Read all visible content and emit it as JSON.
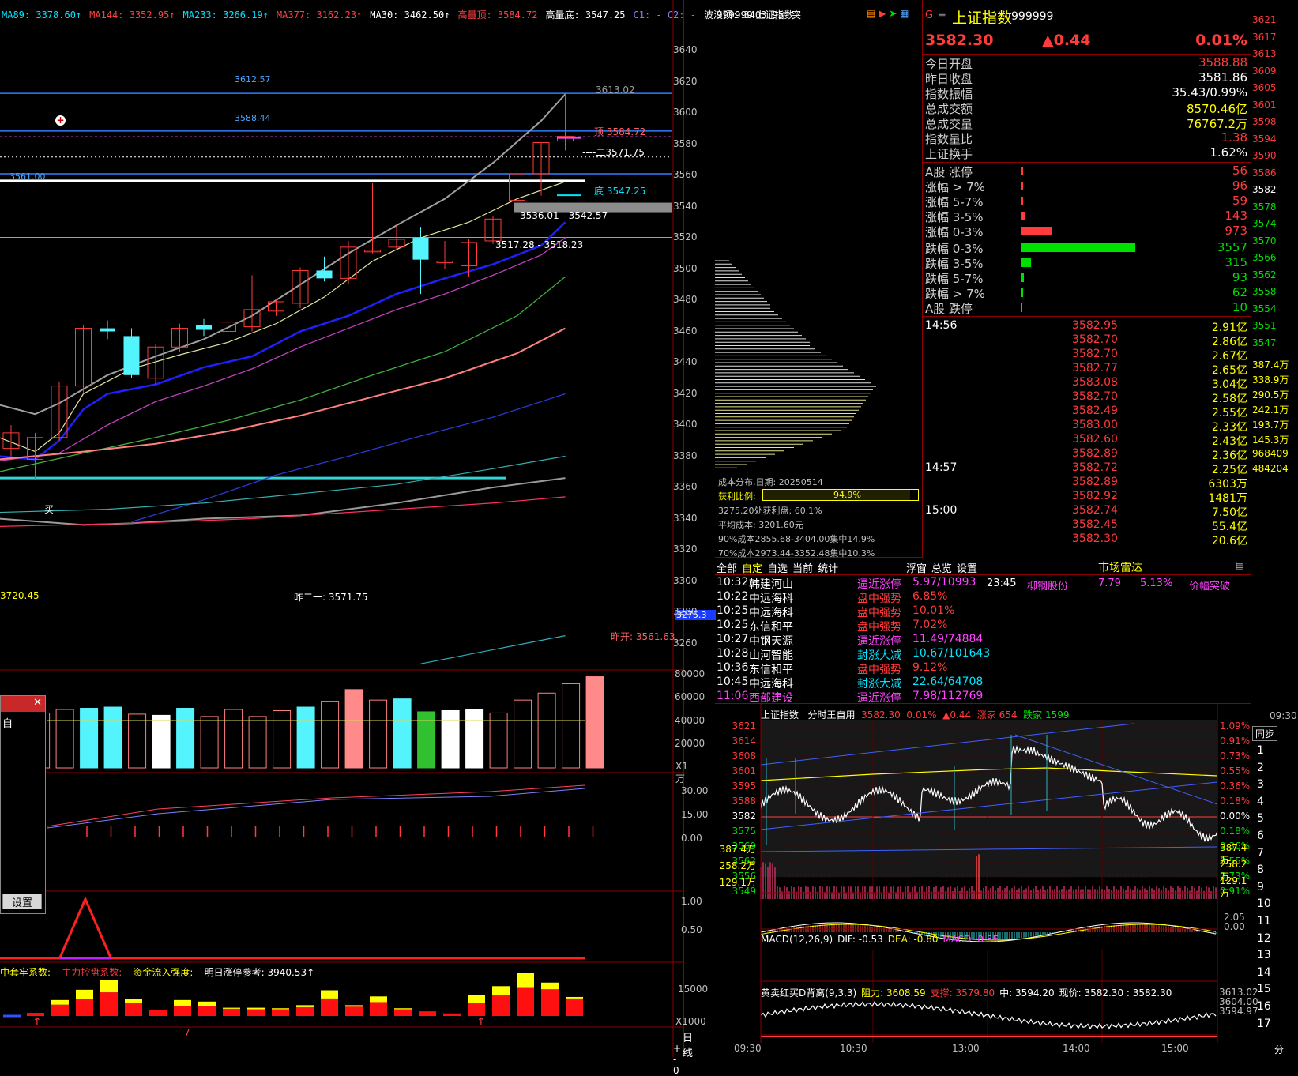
{
  "main_chart": {
    "ma_legend": [
      {
        "text": "MA89: 3378.60↑",
        "color": "#00e5ff"
      },
      {
        "text": "MA144: 3352.95↑",
        "color": "#ff4040"
      },
      {
        "text": "MA233: 3266.19↑",
        "color": "#00e5ff"
      },
      {
        "text": "MA377: 3162.23↑",
        "color": "#ff4040"
      },
      {
        "text": "MA30: 3462.50↑",
        "color": "#ffffff"
      },
      {
        "text": "高量顶: 3584.72",
        "color": "#ff4040"
      },
      {
        "text": "高量底: 3547.25",
        "color": "#ffffff"
      },
      {
        "text": "C1: - C2: -",
        "color": "#8080ff"
      },
      {
        "text": "波浪顶: 3403.95",
        "color": "#ffffff"
      },
      {
        "text": "突",
        "color": "#ffffff"
      }
    ],
    "y_ticks": [
      "3640",
      "3620",
      "3600",
      "3580",
      "3560",
      "3540",
      "3520",
      "3500",
      "3480",
      "3460",
      "3440",
      "3420",
      "3400",
      "3380",
      "3360",
      "3340",
      "3320",
      "3300",
      "3280",
      "3260"
    ],
    "annotations": {
      "line_3612": "3612.57",
      "line_3588": "3588.44",
      "line_3561": "3561.00",
      "high": "3613.02",
      "top": "顶  3584.72",
      "second": "----二3571.75",
      "bottom": "底  3547.25",
      "range1": "3536.01 - 3542.57",
      "range2": "3517.28 - 3518.23",
      "left_value": "3720.45",
      "yest_second": "昨二一:  3571.75",
      "yest_open": "昨开:  3561.63",
      "current_tag": "3275.3",
      "buy_label": "买"
    },
    "candles": [
      {
        "o": 3395,
        "c": 3385,
        "h": 3400,
        "l": 3380,
        "color": "red"
      },
      {
        "o": 3378,
        "c": 3392,
        "h": 3395,
        "l": 3365,
        "color": "red"
      },
      {
        "o": 3392,
        "c": 3425,
        "h": 3428,
        "l": 3390,
        "color": "red"
      },
      {
        "o": 3425,
        "c": 3462,
        "h": 3464,
        "l": 3420,
        "color": "red"
      },
      {
        "o": 3460,
        "c": 3462,
        "h": 3467,
        "l": 3455,
        "color": "cyan"
      },
      {
        "o": 3457,
        "c": 3432,
        "h": 3462,
        "l": 3430,
        "color": "cyan"
      },
      {
        "o": 3430,
        "c": 3450,
        "h": 3452,
        "l": 3426,
        "color": "red"
      },
      {
        "o": 3450,
        "c": 3462,
        "h": 3465,
        "l": 3447,
        "color": "red"
      },
      {
        "o": 3461,
        "c": 3464,
        "h": 3468,
        "l": 3457,
        "color": "cyan"
      },
      {
        "o": 3460,
        "c": 3466,
        "h": 3470,
        "l": 3456,
        "color": "red"
      },
      {
        "o": 3463,
        "c": 3474,
        "h": 3496,
        "l": 3460,
        "color": "red"
      },
      {
        "o": 3473,
        "c": 3479,
        "h": 3481,
        "l": 3470,
        "color": "red"
      },
      {
        "o": 3478,
        "c": 3499,
        "h": 3501,
        "l": 3475,
        "color": "red"
      },
      {
        "o": 3499,
        "c": 3494,
        "h": 3508,
        "l": 3492,
        "color": "cyan"
      },
      {
        "o": 3494,
        "c": 3514,
        "h": 3518,
        "l": 3490,
        "color": "red"
      },
      {
        "o": 3512,
        "c": 3512,
        "h": 3555,
        "l": 3510,
        "color": "red"
      },
      {
        "o": 3514,
        "c": 3519,
        "h": 3528,
        "l": 3512,
        "color": "red"
      },
      {
        "o": 3520,
        "c": 3506,
        "h": 3527,
        "l": 3484,
        "color": "cyan"
      },
      {
        "o": 3505,
        "c": 3505,
        "h": 3518,
        "l": 3500,
        "color": "red"
      },
      {
        "o": 3502,
        "c": 3517,
        "h": 3519,
        "l": 3495,
        "color": "red"
      },
      {
        "o": 3518,
        "c": 3532,
        "h": 3534,
        "l": 3516,
        "color": "red"
      },
      {
        "o": 3544,
        "c": 3561,
        "h": 3563,
        "l": 3541,
        "color": "red"
      },
      {
        "o": 3561,
        "c": 3581,
        "h": 3581,
        "l": 3547,
        "color": "red"
      },
      {
        "o": 3582,
        "c": 3585,
        "h": 3613,
        "l": 3576,
        "color": "red"
      }
    ],
    "volume_ticks": [
      "80000",
      "60000",
      "40000",
      "20000"
    ],
    "volume_unit": "X1万",
    "volume_bars": [
      {
        "v": 47000,
        "color": "pink"
      },
      {
        "v": 50000,
        "color": "pink"
      },
      {
        "v": 51000,
        "color": "cyan"
      },
      {
        "v": 52000,
        "color": "cyan"
      },
      {
        "v": 46000,
        "color": "pink"
      },
      {
        "v": 45000,
        "color": "white"
      },
      {
        "v": 51000,
        "color": "cyan"
      },
      {
        "v": 44000,
        "color": "pink"
      },
      {
        "v": 50000,
        "color": "pink"
      },
      {
        "v": 44000,
        "color": "pink"
      },
      {
        "v": 49000,
        "color": "pink"
      },
      {
        "v": 52000,
        "color": "cyan"
      },
      {
        "v": 57000,
        "color": "pink"
      },
      {
        "v": 67000,
        "color": "salmon"
      },
      {
        "v": 58000,
        "color": "pink"
      },
      {
        "v": 59000,
        "color": "cyan"
      },
      {
        "v": 48000,
        "color": "green"
      },
      {
        "v": 49000,
        "color": "white"
      },
      {
        "v": 50000,
        "color": "white"
      },
      {
        "v": 47000,
        "color": "pink"
      },
      {
        "v": 58000,
        "color": "pink"
      },
      {
        "v": 64000,
        "color": "pink"
      },
      {
        "v": 72000,
        "color": "pink"
      },
      {
        "v": 78000,
        "color": "salmon"
      }
    ],
    "ind2_ticks": [
      "30.00",
      "15.00",
      "0.00"
    ],
    "ind3_ticks": [
      "1.00",
      "0.50"
    ],
    "bottom_legend": [
      {
        "text": "中套牢系数: -",
        "color": "#ffff00"
      },
      {
        "text": "主力控盘系数: -",
        "color": "#ff3b3b"
      },
      {
        "text": "资金流入强度: -",
        "color": "#ffff00"
      },
      {
        "text": "明日涨停参考: 3940.53↑",
        "color": "#ffffff"
      }
    ],
    "ind4_ticks": [
      "15000"
    ],
    "ind4_unit": "X1000",
    "ind4_bars": [
      {
        "r": 600,
        "y": 0
      },
      {
        "r": 2200,
        "y": 900
      },
      {
        "r": 3300,
        "y": 1800
      },
      {
        "r": 4600,
        "y": 2400
      },
      {
        "r": 2600,
        "y": 700
      },
      {
        "r": 1100,
        "y": 0
      },
      {
        "r": 1900,
        "y": 1200
      },
      {
        "r": 2000,
        "y": 800
      },
      {
        "r": 1400,
        "y": 200
      },
      {
        "r": 1300,
        "y": 300
      },
      {
        "r": 1300,
        "y": 200
      },
      {
        "r": 1700,
        "y": 400
      },
      {
        "r": 3400,
        "y": 1600
      },
      {
        "r": 1800,
        "y": 300
      },
      {
        "r": 2700,
        "y": 1100
      },
      {
        "r": 1300,
        "y": 200
      },
      {
        "r": 900,
        "y": 0
      },
      {
        "r": 500,
        "y": 0
      },
      {
        "r": 2600,
        "y": 1400
      },
      {
        "r": 4000,
        "y": 1800
      },
      {
        "r": 5600,
        "y": 2800
      },
      {
        "r": 5200,
        "y": 1300
      },
      {
        "r": 3400,
        "y": 300
      }
    ],
    "period_label": "日线",
    "date_mark": "7",
    "zoom_controls": [
      "+",
      "-",
      "0"
    ]
  },
  "left_popup": {
    "item": "自",
    "settings_button": "设置",
    "close": "✕"
  },
  "chip_panel": {
    "title": "999999 上证指数",
    "lines": [
      "成本分布,日期: 20250514",
      "获利比例:",
      "94.9%",
      "3275.20处获利盘: 60.1%",
      "平均成本: 3201.60元",
      "90%成本2855.68-3404.00集中14.9%",
      "70%成本2973.44-3352.48集中10.3%"
    ]
  },
  "quote": {
    "title": "上证指数",
    "code": "999999",
    "price": "3582.30",
    "change": "▲0.44",
    "change_pct": "0.01%",
    "stats": [
      {
        "label": "今日开盘",
        "value": "3588.88",
        "color": "#ff3b3b"
      },
      {
        "label": "昨日收盘",
        "value": "3581.86",
        "color": "#ffffff"
      },
      {
        "label": "指数振幅",
        "value": "35.43/0.99%",
        "color": "#ffffff"
      },
      {
        "label": "总成交额",
        "value": "8570.46亿",
        "color": "#ffff00"
      },
      {
        "label": "总成交量",
        "value": "76767.2万",
        "color": "#ffff00"
      },
      {
        "label": "指数量比",
        "value": "1.38",
        "color": "#ff3b3b"
      },
      {
        "label": "上证换手",
        "value": "1.62%",
        "color": "#ffffff"
      }
    ],
    "breadth_up": [
      {
        "label": "A股 涨停",
        "value": "56",
        "bar": 0.02
      },
      {
        "label": "涨幅 > 7%",
        "value": "96",
        "bar": 0.02
      },
      {
        "label": "涨幅 5-7%",
        "value": "59",
        "bar": 0.02
      },
      {
        "label": "涨幅 3-5%",
        "value": "143",
        "bar": 0.04
      },
      {
        "label": "涨幅 0-3%",
        "value": "973",
        "bar": 0.27
      }
    ],
    "breadth_down": [
      {
        "label": "跌幅 0-3%",
        "value": "3557",
        "bar": 1.0
      },
      {
        "label": "跌幅 3-5%",
        "value": "315",
        "bar": 0.09
      },
      {
        "label": "跌幅 5-7%",
        "value": "93",
        "bar": 0.03
      },
      {
        "label": "跌幅 > 7%",
        "value": "62",
        "bar": 0.02
      },
      {
        "label": "A股 跌停",
        "value": "10",
        "bar": 0.01
      }
    ],
    "ticks": [
      {
        "time": "14:56",
        "price": "3582.95",
        "amount": "2.91亿"
      },
      {
        "time": "",
        "price": "3582.70",
        "amount": "2.86亿"
      },
      {
        "time": "",
        "price": "3582.70",
        "amount": "2.67亿"
      },
      {
        "time": "",
        "price": "3582.77",
        "amount": "2.65亿"
      },
      {
        "time": "",
        "price": "3583.08",
        "amount": "3.04亿"
      },
      {
        "time": "",
        "price": "3582.70",
        "amount": "2.58亿"
      },
      {
        "time": "",
        "price": "3582.49",
        "amount": "2.55亿"
      },
      {
        "time": "",
        "price": "3583.00",
        "amount": "2.33亿"
      },
      {
        "time": "",
        "price": "3582.60",
        "amount": "2.43亿"
      },
      {
        "time": "",
        "price": "3582.89",
        "amount": "2.36亿"
      },
      {
        "time": "14:57",
        "price": "3582.72",
        "amount": "2.25亿"
      },
      {
        "time": "",
        "price": "3582.89",
        "amount": "6303万"
      },
      {
        "time": "",
        "price": "3582.92",
        "amount": "1481万"
      },
      {
        "time": "15:00",
        "price": "3582.74",
        "amount": "7.50亿"
      },
      {
        "time": "",
        "price": "3582.45",
        "amount": "55.4亿"
      },
      {
        "time": "",
        "price": "3582.30",
        "amount": "20.6亿"
      }
    ]
  },
  "news": {
    "tabs": [
      "全部",
      "自定",
      "自选",
      "当前",
      "统计"
    ],
    "right_tabs": [
      "浮窗",
      "总览",
      "设置"
    ],
    "rows": [
      {
        "time": "10:32",
        "name": "韩建河山",
        "type": "逼近涨停",
        "type_color": "#ff44ff",
        "val": "5.97/10993",
        "val_color": "#ff44ff"
      },
      {
        "time": "10:22",
        "name": "中远海科",
        "type": "盘中强势",
        "type_color": "#ff3b3b",
        "val": "6.85%",
        "val_color": "#ff3b3b"
      },
      {
        "time": "10:25",
        "name": "中远海科",
        "type": "盘中强势",
        "type_color": "#ff3b3b",
        "val": "10.01%",
        "val_color": "#ff3b3b"
      },
      {
        "time": "10:25",
        "name": "东信和平",
        "type": "盘中强势",
        "type_color": "#ff3b3b",
        "val": "7.02%",
        "val_color": "#ff3b3b"
      },
      {
        "time": "10:27",
        "name": "中钢天源",
        "type": "逼近涨停",
        "type_color": "#ff44ff",
        "val": "11.49/74884",
        "val_color": "#ff44ff"
      },
      {
        "time": "10:28",
        "name": "山河智能",
        "type": "封涨大减",
        "type_color": "#00e5ff",
        "val": "10.67/101643",
        "val_color": "#00e5ff"
      },
      {
        "time": "10:36",
        "name": "东信和平",
        "type": "盘中强势",
        "type_color": "#ff3b3b",
        "val": "9.12%",
        "val_color": "#ff3b3b"
      },
      {
        "time": "10:45",
        "name": "中远海科",
        "type": "封涨大减",
        "type_color": "#00e5ff",
        "val": "22.64/64708",
        "val_color": "#00e5ff"
      },
      {
        "time": "11:06",
        "name": "西部建设",
        "type": "逼近涨停",
        "type_color": "#ff44ff",
        "val": "7.98/112769",
        "val_color": "#ff44ff"
      }
    ],
    "radar_title": "市场雷达",
    "radar_row": {
      "time": "23:45",
      "name": "柳钢股份",
      "price": "7.79",
      "pct": "5.13%",
      "event": "价幅突破"
    }
  },
  "intraday": {
    "title": "上证指数",
    "subtitle": "分时王自用",
    "price": "3582.30",
    "pct": "0.01%",
    "chg": "▲0.44",
    "up": "涨家 654",
    "down": "跌家 1599",
    "left_ticks": [
      "3621",
      "3614",
      "3608",
      "3601",
      "3595",
      "3588",
      "3582",
      "3575",
      "3569",
      "3562",
      "3556",
      "3549"
    ],
    "right_ticks": [
      "1.09%",
      "0.91%",
      "0.73%",
      "0.55%",
      "0.36%",
      "0.18%",
      "0.00%",
      "0.18%",
      "0.36%",
      "0.55%",
      "0.73%",
      "0.91%"
    ],
    "vol_ticks": [
      "387.4万",
      "258.2万",
      "129.1万"
    ],
    "macd_legend": [
      {
        "text": "MACD(12,26,9)",
        "color": "#ffffff"
      },
      {
        "text": "DIF: -0.53",
        "color": "#ffffff"
      },
      {
        "text": "DEA: -0.80",
        "color": "#ffff00"
      },
      {
        "text": "MACD: 0.55",
        "color": "#ff44ff"
      }
    ],
    "macd_ticks": [
      "2.05",
      "0.00"
    ],
    "div_legend": [
      {
        "text": "黄卖红买D背离(9,3,3)",
        "color": "#ffffff"
      },
      {
        "text": "阻力: 3608.59",
        "color": "#ffff00"
      },
      {
        "text": "支撑: 3579.80",
        "color": "#ff3b3b"
      },
      {
        "text": "中: 3594.20",
        "color": "#ffffff"
      },
      {
        "text": "现价: 3582.30 : 3582.30",
        "color": "#ffffff"
      }
    ],
    "div_ticks": [
      "3613.02",
      "3604.00",
      "3594.97"
    ],
    "time_axis": [
      "09:30",
      "10:30",
      "13:00",
      "14:00",
      "15:00"
    ]
  },
  "far_right": {
    "values": [
      "3621",
      "3617",
      "3613",
      "3609",
      "3605",
      "3601",
      "3598",
      "3594",
      "3590",
      "3586",
      "3582",
      "3578",
      "3574",
      "3570",
      "3566",
      "3562",
      "3558",
      "3554",
      "3551",
      "3547"
    ],
    "vols": [
      "387.4万",
      "338.9万",
      "290.5万",
      "242.1万",
      "193.7万",
      "145.3万",
      "968409",
      "484204"
    ],
    "time_label": "09:30",
    "tab_label": "同步",
    "numbers": [
      "1",
      "2",
      "3",
      "4",
      "5",
      "6",
      "7",
      "8",
      "9",
      "10",
      "11",
      "12",
      "13",
      "14",
      "15",
      "16",
      "17"
    ],
    "bottom": "分"
  }
}
